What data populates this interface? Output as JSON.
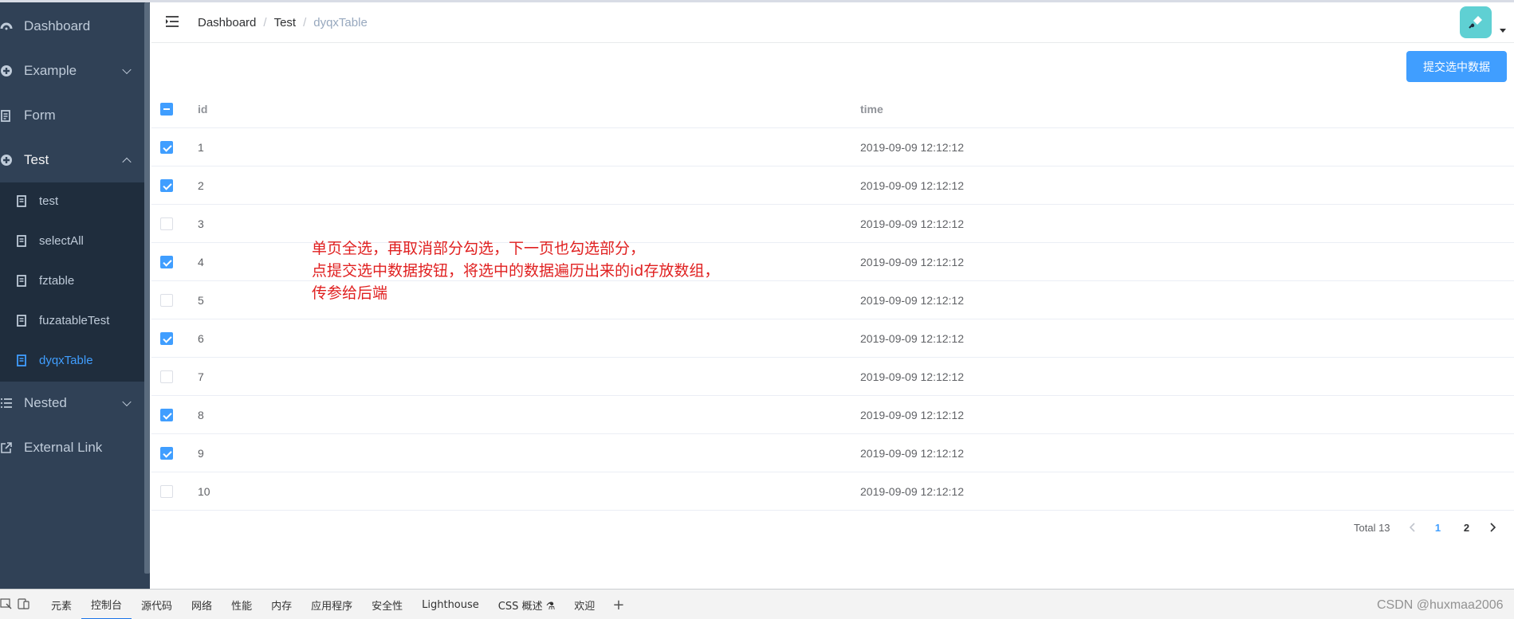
{
  "sidebar": {
    "items": [
      {
        "label": "Dashboard",
        "icon": "dashboard-icon"
      },
      {
        "label": "Example",
        "icon": "example-icon"
      },
      {
        "label": "Form",
        "icon": "form-icon"
      },
      {
        "label": "Test",
        "icon": "test-icon"
      },
      {
        "label": "Nested",
        "icon": "nested-icon"
      },
      {
        "label": "External Link",
        "icon": "external-link-icon"
      }
    ],
    "sub_items": [
      {
        "label": "test"
      },
      {
        "label": "selectAll"
      },
      {
        "label": "fztable"
      },
      {
        "label": "fuzatableTest"
      },
      {
        "label": "dyqxTable"
      }
    ],
    "active_sub": "dyqxTable"
  },
  "breadcrumb": [
    "Dashboard",
    "Test",
    "dyqxTable"
  ],
  "submit_button": "提交选中数据",
  "table": {
    "headers": {
      "id": "id",
      "time": "time"
    },
    "rows": [
      {
        "id": "1",
        "time": "2019-09-09 12:12:12",
        "checked": true
      },
      {
        "id": "2",
        "time": "2019-09-09 12:12:12",
        "checked": true
      },
      {
        "id": "3",
        "time": "2019-09-09 12:12:12",
        "checked": false
      },
      {
        "id": "4",
        "time": "2019-09-09 12:12:12",
        "checked": true
      },
      {
        "id": "5",
        "time": "2019-09-09 12:12:12",
        "checked": false
      },
      {
        "id": "6",
        "time": "2019-09-09 12:12:12",
        "checked": true
      },
      {
        "id": "7",
        "time": "2019-09-09 12:12:12",
        "checked": false
      },
      {
        "id": "8",
        "time": "2019-09-09 12:12:12",
        "checked": true
      },
      {
        "id": "9",
        "time": "2019-09-09 12:12:12",
        "checked": true
      },
      {
        "id": "10",
        "time": "2019-09-09 12:12:12",
        "checked": false
      }
    ]
  },
  "annotation": [
    "单页全选，再取消部分勾选，下一页也勾选部分，",
    "点提交选中数据按钮，将选中的数据遍历出来的id存放数组，",
    "传参给后端"
  ],
  "pagination": {
    "total": "Total 13",
    "pages": [
      "1",
      "2"
    ],
    "current": "1"
  },
  "devtools": {
    "tabs": [
      "元素",
      "控制台",
      "源代码",
      "网络",
      "性能",
      "内存",
      "应用程序",
      "安全性",
      "Lighthouse",
      "CSS 概述 ⚗",
      "欢迎"
    ],
    "active_tab": "控制台",
    "watermark": "CSDN @huxmaa2006"
  },
  "colors": {
    "sidebar_bg": "#304156",
    "accent": "#409eff",
    "annotation": "#e02020"
  }
}
